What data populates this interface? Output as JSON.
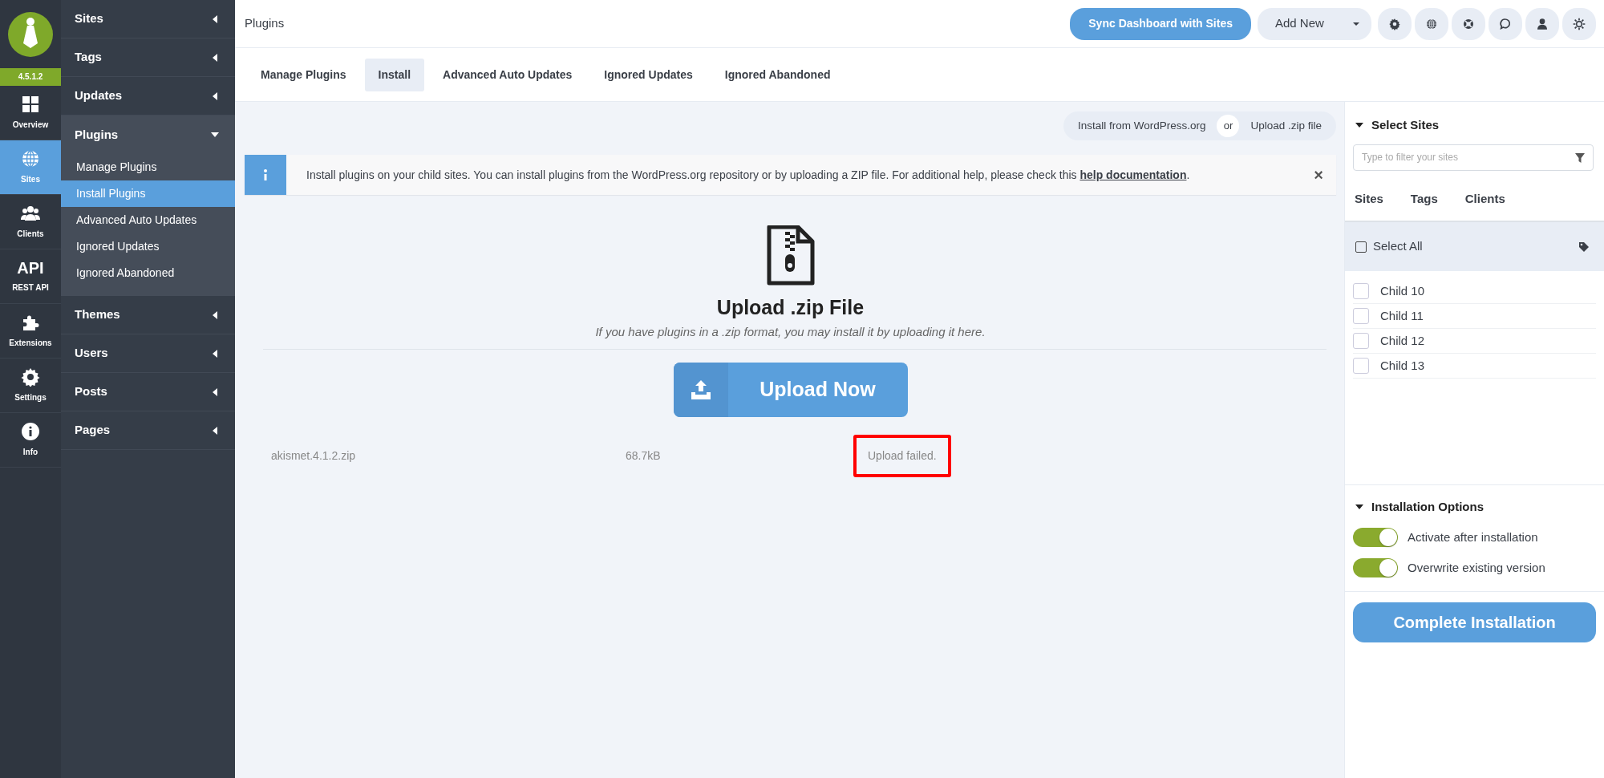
{
  "rail": {
    "version": "4.5.1.2",
    "items": [
      {
        "label": "Overview",
        "selected": false
      },
      {
        "label": "Sites",
        "selected": true
      },
      {
        "label": "Clients",
        "selected": false
      },
      {
        "label": "REST API",
        "badge": "API",
        "selected": false
      },
      {
        "label": "Extensions",
        "selected": false
      },
      {
        "label": "Settings",
        "selected": false
      },
      {
        "label": "Info",
        "selected": false
      }
    ]
  },
  "nav": {
    "items": [
      {
        "label": "Sites",
        "expanded": false
      },
      {
        "label": "Tags",
        "expanded": false
      },
      {
        "label": "Updates",
        "expanded": false
      },
      {
        "label": "Plugins",
        "expanded": true,
        "children": [
          {
            "label": "Manage Plugins",
            "selected": false
          },
          {
            "label": "Install Plugins",
            "selected": true
          },
          {
            "label": "Advanced Auto Updates",
            "selected": false
          },
          {
            "label": "Ignored Updates",
            "selected": false
          },
          {
            "label": "Ignored Abandoned",
            "selected": false
          }
        ]
      },
      {
        "label": "Themes",
        "expanded": false
      },
      {
        "label": "Users",
        "expanded": false
      },
      {
        "label": "Posts",
        "expanded": false
      },
      {
        "label": "Pages",
        "expanded": false
      }
    ]
  },
  "header": {
    "title": "Plugins",
    "sync_button": "Sync Dashboard with Sites",
    "add_new": "Add New"
  },
  "tabs": [
    {
      "label": "Manage Plugins",
      "selected": false
    },
    {
      "label": "Install",
      "selected": true
    },
    {
      "label": "Advanced Auto Updates",
      "selected": false
    },
    {
      "label": "Ignored Updates",
      "selected": false
    },
    {
      "label": "Ignored Abandoned",
      "selected": false
    }
  ],
  "source_switch": {
    "options": [
      {
        "label": "Install from WordPress.org",
        "selected": false
      },
      {
        "label": "Upload .zip file",
        "selected": false
      }
    ],
    "separator": "or"
  },
  "info_alert": {
    "text": "Install plugins on your child sites. You can install plugins from the WordPress.org repository or by uploading a ZIP file. For additional help, please check this ",
    "link": "help documentation",
    "after": ".",
    "close": "×"
  },
  "upload": {
    "title": "Upload .zip File",
    "subtitle": "If you have plugins in a .zip format, you may install it by uploading it here.",
    "button": "Upload Now",
    "files": [
      {
        "name": "akismet.4.1.2.zip",
        "size": "68.7kB",
        "status": "Upload failed.",
        "highlighted": true
      }
    ]
  },
  "right_panel": {
    "select_sites": {
      "title": "Select Sites",
      "expanded": true,
      "filter_placeholder": "Type to filter your sites",
      "tabs": [
        {
          "label": "Sites",
          "selected": false
        },
        {
          "label": "Tags",
          "selected": false
        },
        {
          "label": "Clients",
          "selected": false
        }
      ],
      "select_all": {
        "label": "Select All",
        "checked": false
      },
      "sites": [
        {
          "label": "Child 10",
          "checked": false
        },
        {
          "label": "Child 11",
          "checked": false
        },
        {
          "label": "Child 12",
          "checked": false
        },
        {
          "label": "Child 13",
          "checked": false
        }
      ]
    },
    "installation_options": {
      "title": "Installation Options",
      "expanded": true,
      "options": [
        {
          "label": "Activate after installation",
          "on": true
        },
        {
          "label": "Overwrite existing version",
          "on": true
        }
      ]
    },
    "complete_button": "Complete Installation"
  }
}
